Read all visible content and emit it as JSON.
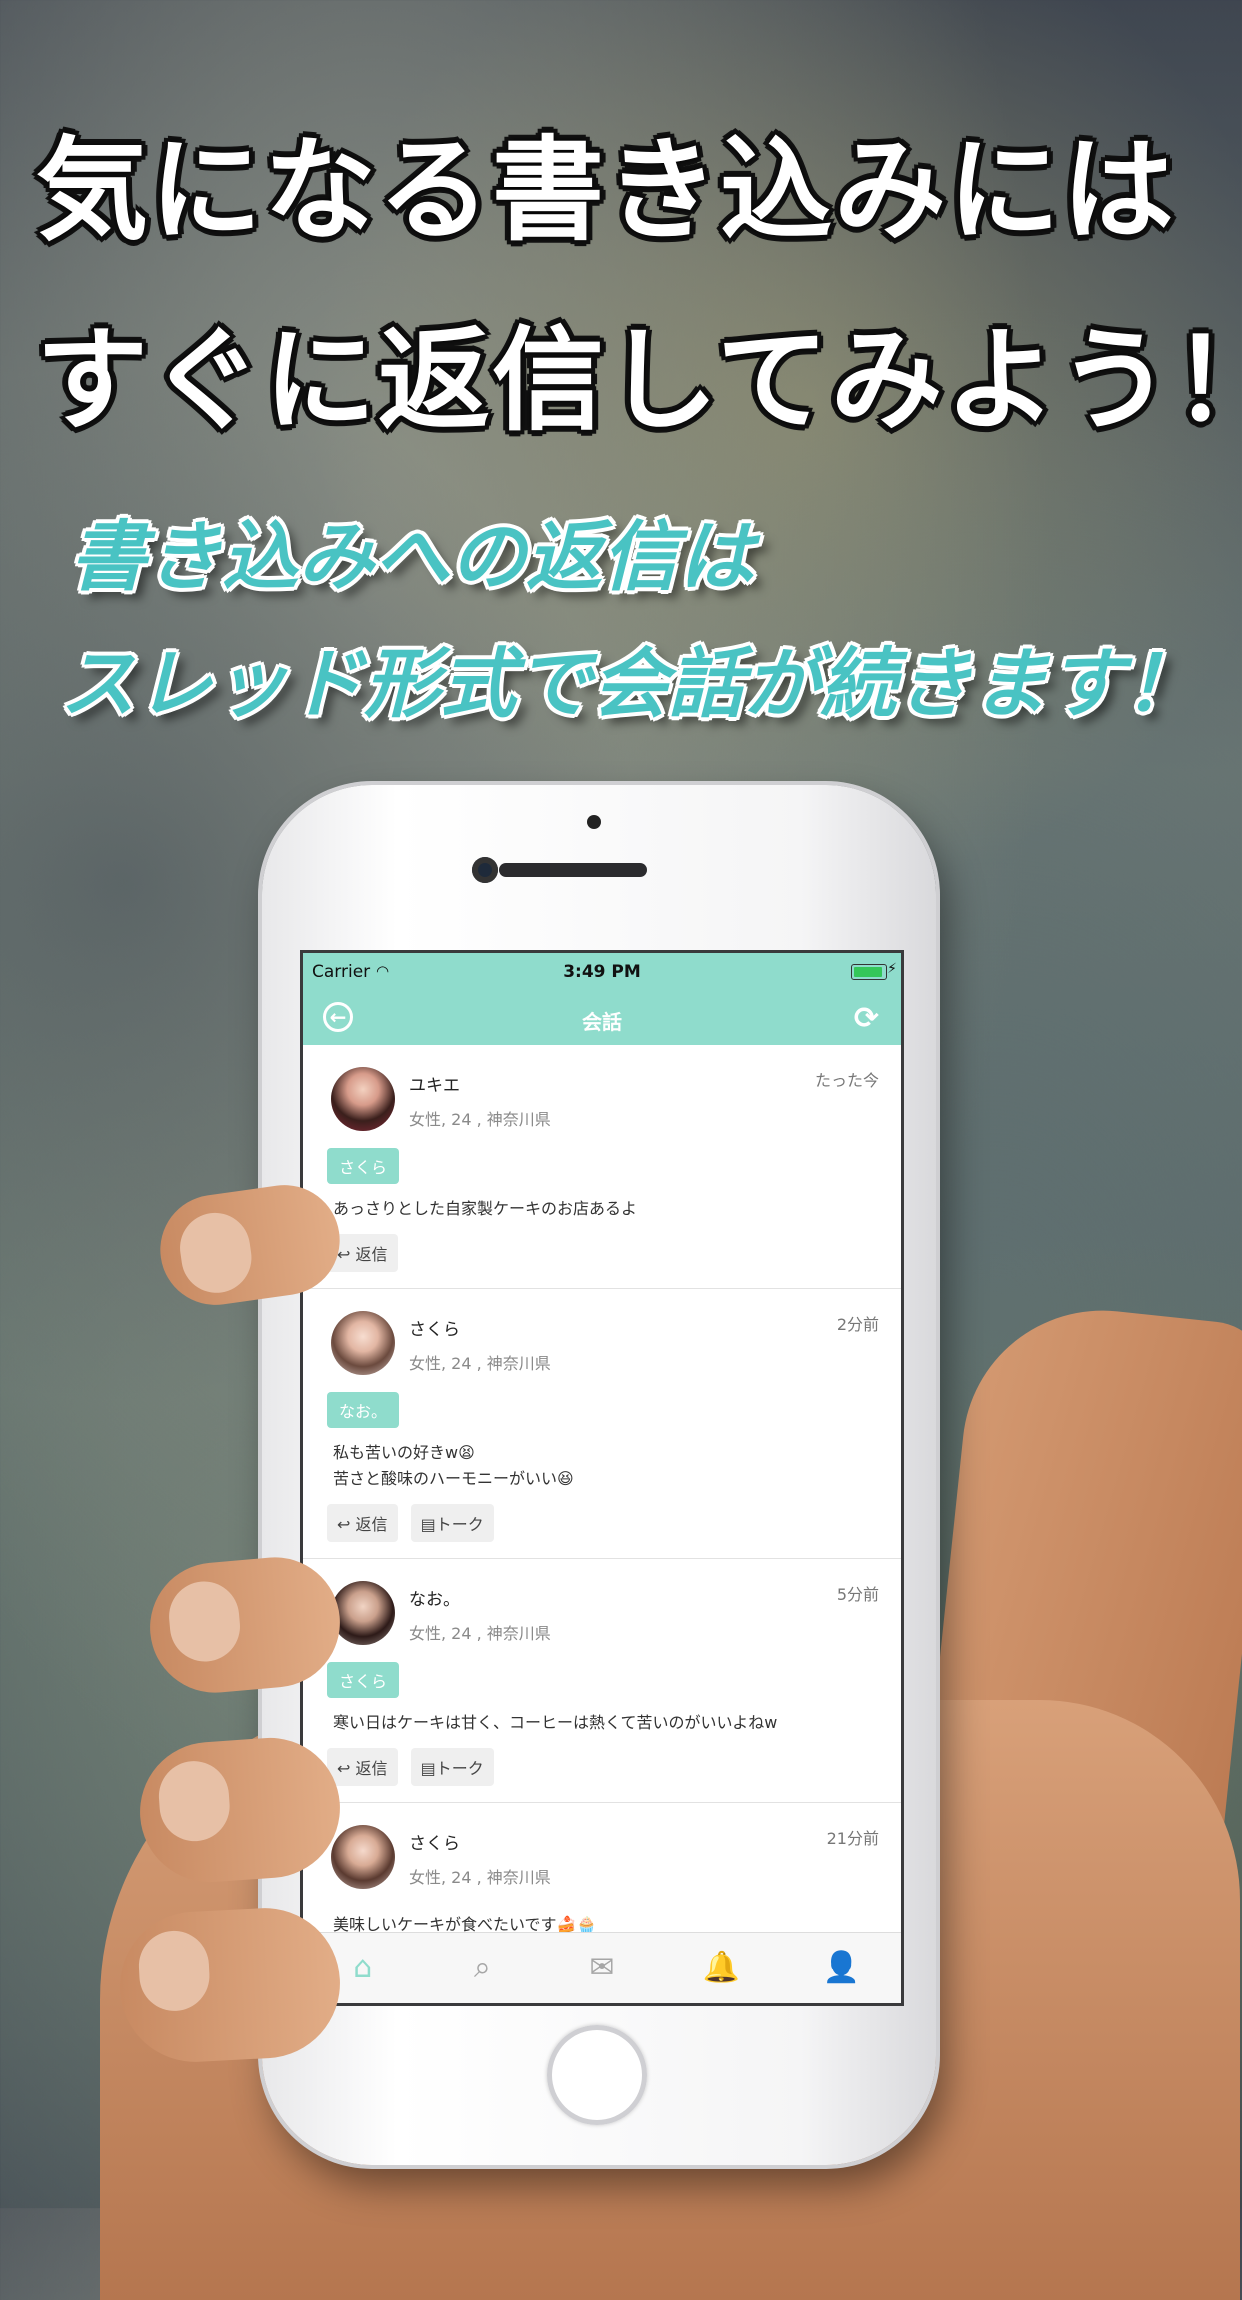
{
  "headline": {
    "line1": "気になる書き込みには",
    "line2": "すぐに返信してみよう！"
  },
  "subheadline": {
    "line1": "書き込みへの返信は",
    "line2": "スレッド形式で会話が続きます！"
  },
  "status_bar": {
    "carrier": "Carrier",
    "time": "3:49 PM"
  },
  "nav": {
    "title": "会話",
    "back_icon": "back-circle-icon",
    "refresh_icon": "refresh-icon"
  },
  "colors": {
    "accent": "#8fdccc",
    "accent_text": "#49c3c3"
  },
  "posts": [
    {
      "name": "ユキエ",
      "meta": "女性, 24 , 神奈川県",
      "time": "たった今",
      "reply_to": "さくら",
      "body": "あっさりとした自家製ケーキのお店あるよ",
      "reply_label": "返信"
    },
    {
      "name": "さくら",
      "meta": "女性, 24 , 神奈川県",
      "time": "2分前",
      "reply_to": "なお。",
      "body": "私も苦いの好きw😫\n苦さと酸味のハーモニーがいい😆",
      "reply_label": "返信",
      "talk_label": "トーク"
    },
    {
      "name": "なお。",
      "meta": "女性, 24 , 神奈川県",
      "time": "5分前",
      "reply_to": "さくら",
      "body": "寒い日はケーキは甘く、コーヒーは熱くて苦いのがいいよねw",
      "reply_label": "返信",
      "talk_label": "トーク"
    },
    {
      "name": "さくら",
      "meta": "女性, 24 , 神奈川県",
      "time": "21分前",
      "body": "美味しいケーキが食べたいです🍰🧁"
    }
  ],
  "tabs": [
    {
      "icon": "home-icon",
      "glyph": "⌂"
    },
    {
      "icon": "search-icon",
      "glyph": "⌕"
    },
    {
      "icon": "chat-icon",
      "glyph": "✉"
    },
    {
      "icon": "bell-icon",
      "glyph": "🔔"
    },
    {
      "icon": "profile-icon",
      "glyph": "👤"
    }
  ]
}
